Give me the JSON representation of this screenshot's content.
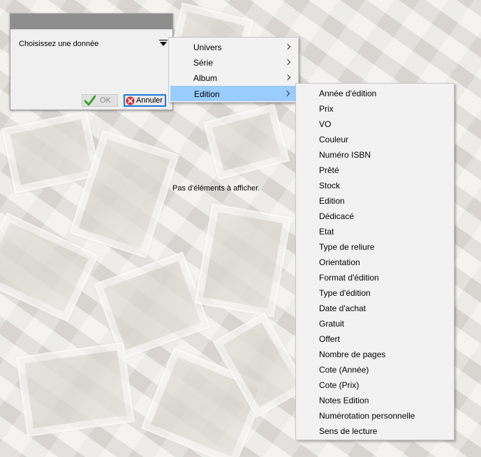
{
  "background": {
    "empty_message": "Pas d'éléments à afficher."
  },
  "dialog": {
    "combo_placeholder": "Choisissez une donnée",
    "ok_label": "OK",
    "cancel_label": "Annuler"
  },
  "menu": {
    "items": [
      {
        "label": "Univers"
      },
      {
        "label": "Série"
      },
      {
        "label": "Album"
      },
      {
        "label": "Edition"
      }
    ],
    "selected": "Edition"
  },
  "submenu": {
    "items": [
      "Année d'édition",
      "Prix",
      "VO",
      "Couleur",
      "Numéro ISBN",
      "Prêté",
      "Stock",
      "Edition",
      "Dédicacé",
      "Etat",
      "Type de reliure",
      "Orientation",
      "Format d'édition",
      "Type d'édition",
      "Date d'achat",
      "Gratuit",
      "Offert",
      "Nombre de pages",
      "Cote (Année)",
      "Cote (Prix)",
      "Notes Edition",
      "Numérotation personnelle",
      "Sens de lecture"
    ]
  },
  "colors": {
    "selection": "#99ccff",
    "focus_border": "#1a7ad4",
    "title_bar": "#8e8e8e"
  }
}
